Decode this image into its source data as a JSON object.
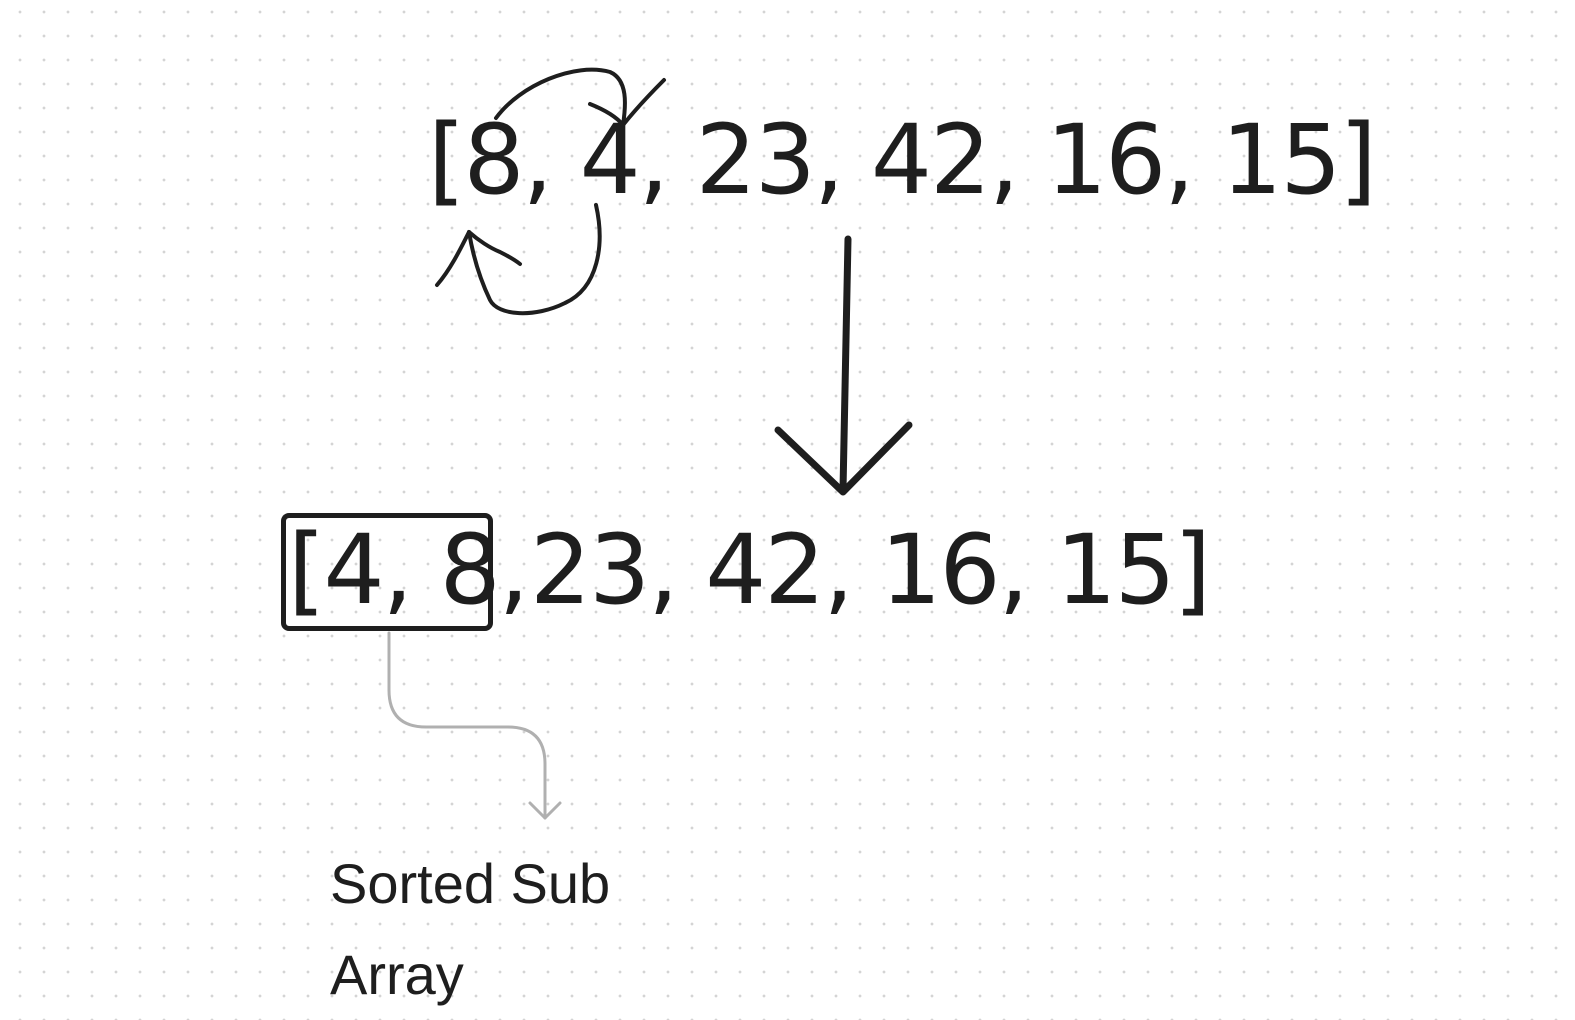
{
  "diagram": {
    "array_before": "[8, 4, 23, 42, 16, 15]",
    "array_after_sorted_part": "[4, 8,",
    "array_after_rest": "23, 42, 16, 15]",
    "label_line_1": "Sorted Sub",
    "label_line_2": "Array"
  },
  "colors": {
    "ink": "#1e1e1e",
    "connector": "#b0b0b0",
    "grid_dots": "#d4d4d4",
    "background": "#ffffff"
  },
  "icons": {
    "swap_arrows": "curved-swap-arrows-icon",
    "transition_arrow": "down-arrow-icon",
    "connector_arrow": "elbow-arrow-icon"
  }
}
